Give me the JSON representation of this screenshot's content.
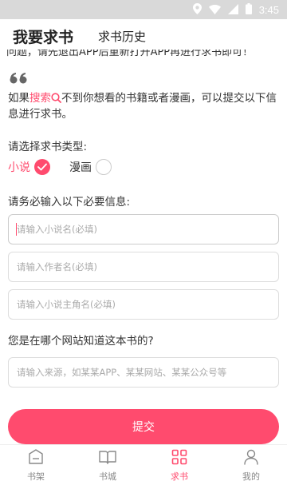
{
  "status_bar": {
    "time": "3:45"
  },
  "tabs": {
    "active": "我要求书",
    "other": "求书历史"
  },
  "clipped_text": "问题，请先退出APP后重新打开APP再进行求书即可！",
  "intro": {
    "part1": "如果",
    "search_word": "搜索",
    "part2": "不到你想看的书籍或者漫画，可以提交以下信息进行求书。"
  },
  "type_section": {
    "label": "请选择求书类型:",
    "options": [
      {
        "label": "小说",
        "selected": true
      },
      {
        "label": "漫画",
        "selected": false
      }
    ]
  },
  "required_label": "请务必输入以下必要信息:",
  "fields": {
    "novel_name": {
      "value": "",
      "placeholder": "请输入小说名(必填)"
    },
    "author": {
      "value": "",
      "placeholder": "请输入作者名(必填)"
    },
    "protagonist": {
      "value": "",
      "placeholder": "请输入小说主角名(必填)"
    }
  },
  "source_question": "您是在哪个网站知道这本书的?",
  "source_field": {
    "value": "",
    "placeholder": "请输入来源，如某某APP、某某网站、某某公众号等"
  },
  "submit_label": "提交",
  "bottom_nav": [
    {
      "label": "书架",
      "icon": "bookshelf-icon",
      "active": false
    },
    {
      "label": "书城",
      "icon": "book-open-icon",
      "active": false
    },
    {
      "label": "求书",
      "icon": "grid-icon",
      "active": true
    },
    {
      "label": "我的",
      "icon": "user-icon",
      "active": false
    }
  ],
  "colors": {
    "accent": "#ff4b6e",
    "status_bar": "#d9d9d9",
    "text": "#333333",
    "placeholder": "#aaaaaa"
  }
}
